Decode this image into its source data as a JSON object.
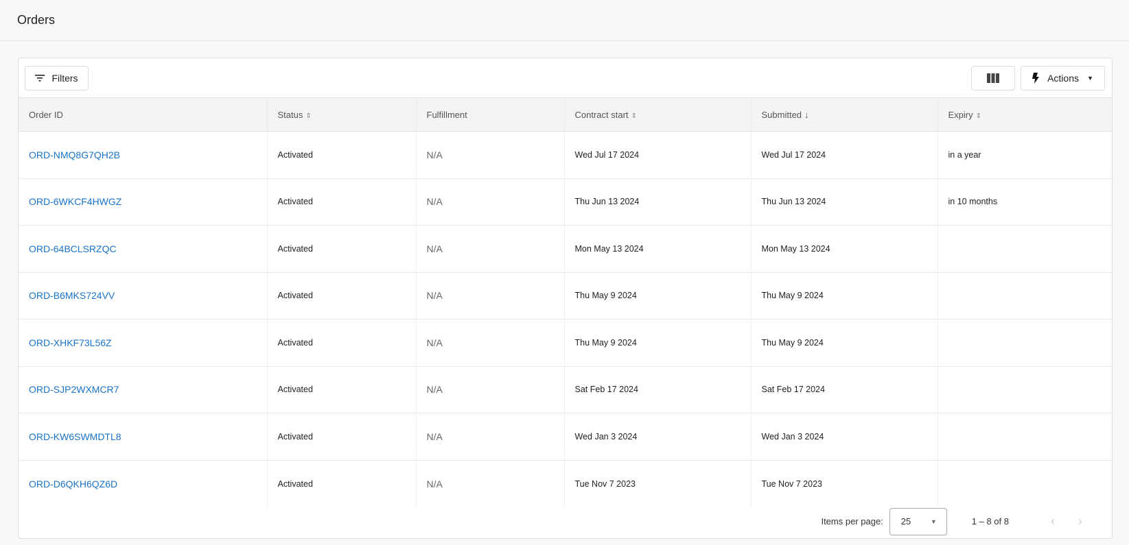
{
  "header": {
    "title": "Orders"
  },
  "toolbar": {
    "filters": "Filters",
    "actions": "Actions"
  },
  "columns": [
    "Order ID",
    "Status",
    "Fulfillment",
    "Contract start",
    "Submitted",
    "Expiry"
  ],
  "rows": [
    {
      "id": "ORD-NMQ8G7QH2B",
      "status": "Activated",
      "fulfillment": "N/A",
      "contract": "Wed Jul 17 2024",
      "submitted": "Wed Jul 17 2024",
      "expiry": "in a year"
    },
    {
      "id": "ORD-6WKCF4HWGZ",
      "status": "Activated",
      "fulfillment": "N/A",
      "contract": "Thu Jun 13 2024",
      "submitted": "Thu Jun 13 2024",
      "expiry": "in 10 months"
    },
    {
      "id": "ORD-64BCLSRZQC",
      "status": "Activated",
      "fulfillment": "N/A",
      "contract": "Mon May 13 2024",
      "submitted": "Mon May 13 2024",
      "expiry": ""
    },
    {
      "id": "ORD-B6MKS724VV",
      "status": "Activated",
      "fulfillment": "N/A",
      "contract": "Thu May 9 2024",
      "submitted": "Thu May 9 2024",
      "expiry": ""
    },
    {
      "id": "ORD-XHKF73L56Z",
      "status": "Activated",
      "fulfillment": "N/A",
      "contract": "Thu May 9 2024",
      "submitted": "Thu May 9 2024",
      "expiry": ""
    },
    {
      "id": "ORD-SJP2WXMCR7",
      "status": "Activated",
      "fulfillment": "N/A",
      "contract": "Sat Feb 17 2024",
      "submitted": "Sat Feb 17 2024",
      "expiry": ""
    },
    {
      "id": "ORD-KW6SWMDTL8",
      "status": "Activated",
      "fulfillment": "N/A",
      "contract": "Wed Jan 3 2024",
      "submitted": "Wed Jan 3 2024",
      "expiry": ""
    },
    {
      "id": "ORD-D6QKH6QZ6D",
      "status": "Activated",
      "fulfillment": "N/A",
      "contract": "Tue Nov 7 2023",
      "submitted": "Tue Nov 7 2023",
      "expiry": ""
    }
  ],
  "pagination": {
    "items_per_page_label": "Items per page:",
    "items_per_page": "25",
    "range": "1 – 8 of 8"
  }
}
